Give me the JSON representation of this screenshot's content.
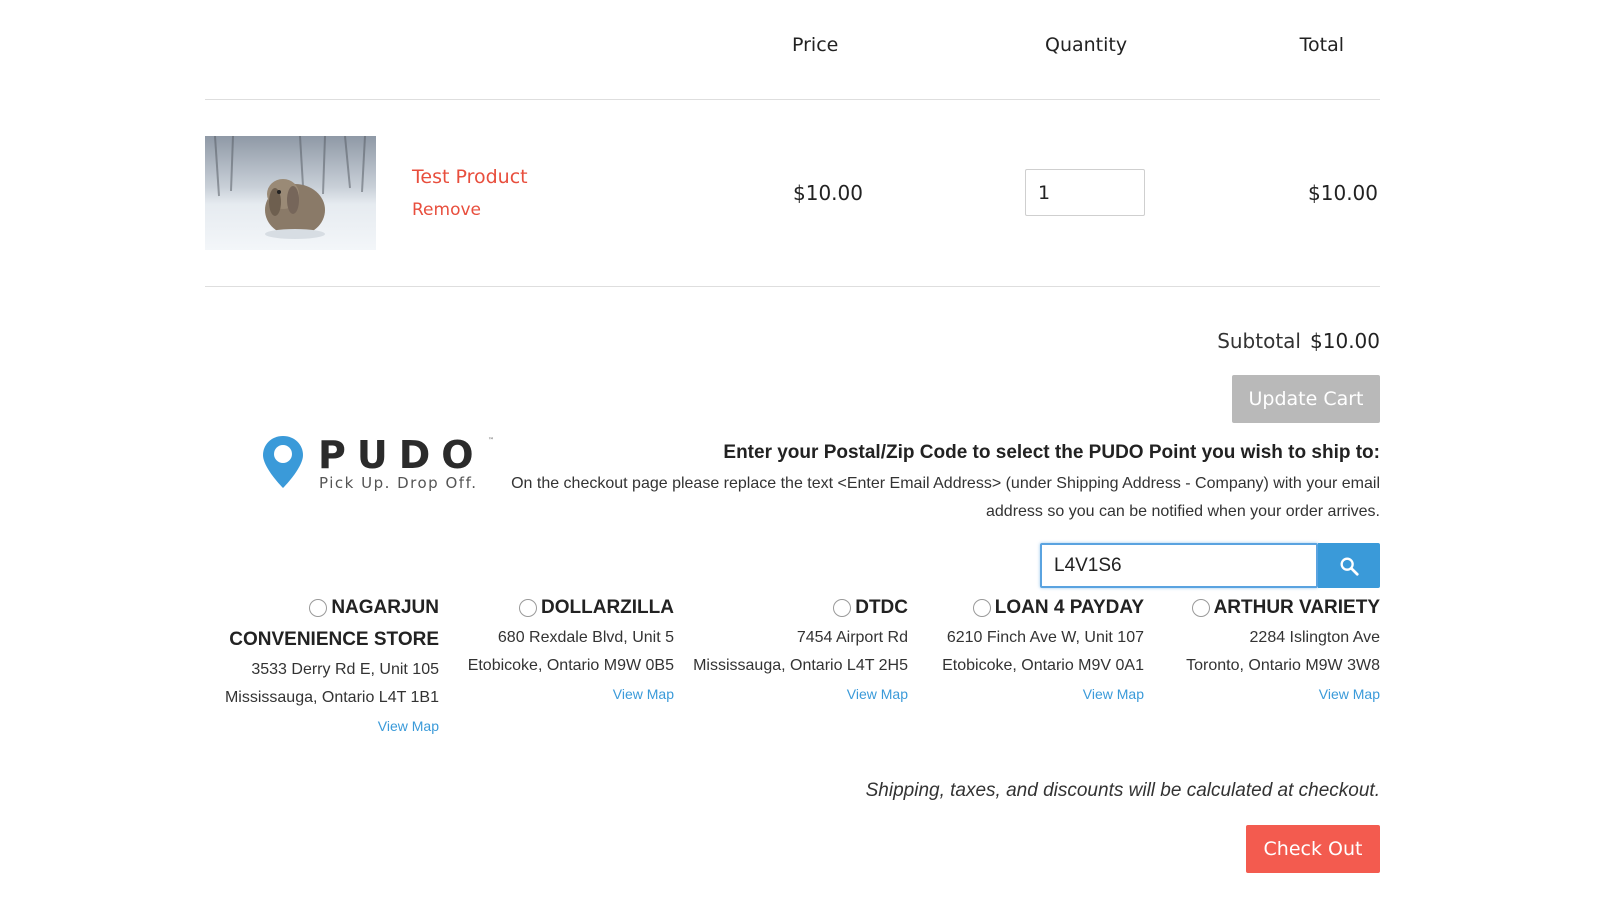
{
  "cart": {
    "headers": {
      "price": "Price",
      "quantity": "Quantity",
      "total": "Total"
    },
    "item": {
      "name": "Test Product",
      "remove_label": "Remove",
      "price": "$10.00",
      "quantity": "1",
      "total": "$10.00"
    },
    "subtotal_label": "Subtotal",
    "subtotal_value": "$10.00",
    "update_label": "Update Cart"
  },
  "pudo": {
    "logo_word": "PUDO",
    "logo_tagline": "Pick Up. Drop Off.",
    "heading": "Enter your Postal/Zip Code to select the PUDO Point you wish to ship to:",
    "instructions": "On the checkout page please replace the text <Enter Email Address> (under Shipping Address - Company) with your email address so you can be notified when your order arrives.",
    "postal_value": "L4V1S6",
    "search_icon": "search-icon",
    "accent": "#3a9ad9",
    "locations": [
      {
        "name_line1": "NAGARJUN",
        "name_line2": "CONVENIENCE STORE",
        "address1": "3533 Derry Rd E, Unit 105",
        "address2": "Mississauga, Ontario L4T 1B1",
        "map_label": "View Map"
      },
      {
        "name_line1": "DOLLARZILLA",
        "address1": "680 Rexdale Blvd, Unit 5",
        "address2": "Etobicoke, Ontario M9W 0B5",
        "map_label": "View Map"
      },
      {
        "name_line1": "DTDC",
        "address1": "7454 Airport Rd",
        "address2": "Mississauga, Ontario L4T 2H5",
        "map_label": "View Map"
      },
      {
        "name_line1": "LOAN 4 PAYDAY",
        "address1": "6210 Finch Ave W, Unit 107",
        "address2": "Etobicoke, Ontario M9V 0A1",
        "map_label": "View Map"
      },
      {
        "name_line1": "ARTHUR VARIETY",
        "address1": "2284 Islington Ave",
        "address2": "Toronto, Ontario M9W 3W8",
        "map_label": "View Map"
      }
    ]
  },
  "footer": {
    "shipping_note": "Shipping, taxes, and discounts will be calculated at checkout.",
    "checkout_label": "Check Out",
    "checkout_color": "#f35b4f"
  }
}
